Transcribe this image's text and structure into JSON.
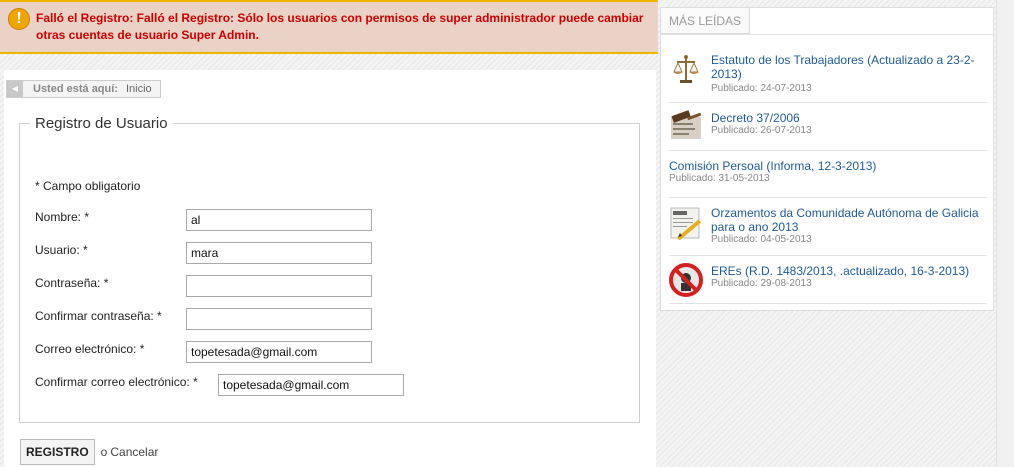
{
  "error": {
    "icon": "exclamation-icon",
    "message": "Falló el Registro: Falló el Registro: Sólo los usuarios con permisos de super administrador puede cambiar otras cuentas de usuario Super Admin."
  },
  "breadcrumb": {
    "label": "Usted está aquí:",
    "home": "Inicio"
  },
  "form": {
    "legend": "Registro de Usuario",
    "required_note": "* Campo obligatorio",
    "fields": [
      {
        "label": "Nombre: *",
        "value": "al"
      },
      {
        "label": "Usuario: *",
        "value": "mara"
      },
      {
        "label": "Contraseña: *",
        "value": ""
      },
      {
        "label": "Confirmar contraseña: *",
        "value": ""
      },
      {
        "label": "Correo electrónico: *",
        "value": "topetesada@gmail.com"
      },
      {
        "label": "Confirmar correo electrónico: *",
        "value": "topetesada@gmail.com"
      }
    ],
    "submit_label": "REGISTRO",
    "or_text": "o",
    "cancel_label": "Cancelar"
  },
  "sidebar": {
    "tab_label": "MÁS LEÍDAS",
    "articles": [
      {
        "title": "Estatuto de los Trabajadores (Actualizado a 23-2-2013)",
        "date": "Publicado: 24-07-2013",
        "thumb": "scales-of-justice-icon"
      },
      {
        "title": "Decreto 37/2006",
        "date": "Publicado: 26-07-2013",
        "thumb": "hammer-document-icon"
      },
      {
        "title": "Comisión Persoal (Informa, 12-3-2013)",
        "date": "Publicado: 31-05-2013",
        "thumb": ""
      },
      {
        "title": "Orzamentos da Comunidade Autónoma de Galicia para o ano 2013",
        "date": "Publicado: 04-05-2013",
        "thumb": "pencil-document-icon"
      },
      {
        "title": "EREs (R.D. 1483/2013, .actualizado, 16-3-2013)",
        "date": "Publicado: 29-08-2013",
        "thumb": "prohibited-sign-icon"
      }
    ]
  }
}
